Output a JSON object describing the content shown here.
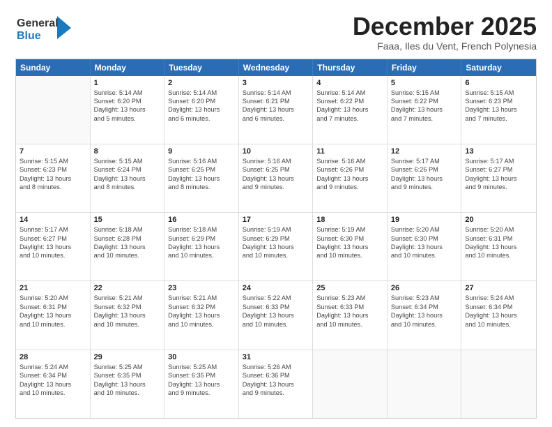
{
  "header": {
    "logo_general": "General",
    "logo_blue": "Blue",
    "month": "December 2025",
    "location": "Faaa, Iles du Vent, French Polynesia"
  },
  "days_of_week": [
    "Sunday",
    "Monday",
    "Tuesday",
    "Wednesday",
    "Thursday",
    "Friday",
    "Saturday"
  ],
  "weeks": [
    [
      {
        "day": "",
        "lines": []
      },
      {
        "day": "1",
        "lines": [
          "Sunrise: 5:14 AM",
          "Sunset: 6:20 PM",
          "Daylight: 13 hours",
          "and 5 minutes."
        ]
      },
      {
        "day": "2",
        "lines": [
          "Sunrise: 5:14 AM",
          "Sunset: 6:20 PM",
          "Daylight: 13 hours",
          "and 6 minutes."
        ]
      },
      {
        "day": "3",
        "lines": [
          "Sunrise: 5:14 AM",
          "Sunset: 6:21 PM",
          "Daylight: 13 hours",
          "and 6 minutes."
        ]
      },
      {
        "day": "4",
        "lines": [
          "Sunrise: 5:14 AM",
          "Sunset: 6:22 PM",
          "Daylight: 13 hours",
          "and 7 minutes."
        ]
      },
      {
        "day": "5",
        "lines": [
          "Sunrise: 5:15 AM",
          "Sunset: 6:22 PM",
          "Daylight: 13 hours",
          "and 7 minutes."
        ]
      },
      {
        "day": "6",
        "lines": [
          "Sunrise: 5:15 AM",
          "Sunset: 6:23 PM",
          "Daylight: 13 hours",
          "and 7 minutes."
        ]
      }
    ],
    [
      {
        "day": "7",
        "lines": [
          "Sunrise: 5:15 AM",
          "Sunset: 6:23 PM",
          "Daylight: 13 hours",
          "and 8 minutes."
        ]
      },
      {
        "day": "8",
        "lines": [
          "Sunrise: 5:15 AM",
          "Sunset: 6:24 PM",
          "Daylight: 13 hours",
          "and 8 minutes."
        ]
      },
      {
        "day": "9",
        "lines": [
          "Sunrise: 5:16 AM",
          "Sunset: 6:25 PM",
          "Daylight: 13 hours",
          "and 8 minutes."
        ]
      },
      {
        "day": "10",
        "lines": [
          "Sunrise: 5:16 AM",
          "Sunset: 6:25 PM",
          "Daylight: 13 hours",
          "and 9 minutes."
        ]
      },
      {
        "day": "11",
        "lines": [
          "Sunrise: 5:16 AM",
          "Sunset: 6:26 PM",
          "Daylight: 13 hours",
          "and 9 minutes."
        ]
      },
      {
        "day": "12",
        "lines": [
          "Sunrise: 5:17 AM",
          "Sunset: 6:26 PM",
          "Daylight: 13 hours",
          "and 9 minutes."
        ]
      },
      {
        "day": "13",
        "lines": [
          "Sunrise: 5:17 AM",
          "Sunset: 6:27 PM",
          "Daylight: 13 hours",
          "and 9 minutes."
        ]
      }
    ],
    [
      {
        "day": "14",
        "lines": [
          "Sunrise: 5:17 AM",
          "Sunset: 6:27 PM",
          "Daylight: 13 hours",
          "and 10 minutes."
        ]
      },
      {
        "day": "15",
        "lines": [
          "Sunrise: 5:18 AM",
          "Sunset: 6:28 PM",
          "Daylight: 13 hours",
          "and 10 minutes."
        ]
      },
      {
        "day": "16",
        "lines": [
          "Sunrise: 5:18 AM",
          "Sunset: 6:29 PM",
          "Daylight: 13 hours",
          "and 10 minutes."
        ]
      },
      {
        "day": "17",
        "lines": [
          "Sunrise: 5:19 AM",
          "Sunset: 6:29 PM",
          "Daylight: 13 hours",
          "and 10 minutes."
        ]
      },
      {
        "day": "18",
        "lines": [
          "Sunrise: 5:19 AM",
          "Sunset: 6:30 PM",
          "Daylight: 13 hours",
          "and 10 minutes."
        ]
      },
      {
        "day": "19",
        "lines": [
          "Sunrise: 5:20 AM",
          "Sunset: 6:30 PM",
          "Daylight: 13 hours",
          "and 10 minutes."
        ]
      },
      {
        "day": "20",
        "lines": [
          "Sunrise: 5:20 AM",
          "Sunset: 6:31 PM",
          "Daylight: 13 hours",
          "and 10 minutes."
        ]
      }
    ],
    [
      {
        "day": "21",
        "lines": [
          "Sunrise: 5:20 AM",
          "Sunset: 6:31 PM",
          "Daylight: 13 hours",
          "and 10 minutes."
        ]
      },
      {
        "day": "22",
        "lines": [
          "Sunrise: 5:21 AM",
          "Sunset: 6:32 PM",
          "Daylight: 13 hours",
          "and 10 minutes."
        ]
      },
      {
        "day": "23",
        "lines": [
          "Sunrise: 5:21 AM",
          "Sunset: 6:32 PM",
          "Daylight: 13 hours",
          "and 10 minutes."
        ]
      },
      {
        "day": "24",
        "lines": [
          "Sunrise: 5:22 AM",
          "Sunset: 6:33 PM",
          "Daylight: 13 hours",
          "and 10 minutes."
        ]
      },
      {
        "day": "25",
        "lines": [
          "Sunrise: 5:23 AM",
          "Sunset: 6:33 PM",
          "Daylight: 13 hours",
          "and 10 minutes."
        ]
      },
      {
        "day": "26",
        "lines": [
          "Sunrise: 5:23 AM",
          "Sunset: 6:34 PM",
          "Daylight: 13 hours",
          "and 10 minutes."
        ]
      },
      {
        "day": "27",
        "lines": [
          "Sunrise: 5:24 AM",
          "Sunset: 6:34 PM",
          "Daylight: 13 hours",
          "and 10 minutes."
        ]
      }
    ],
    [
      {
        "day": "28",
        "lines": [
          "Sunrise: 5:24 AM",
          "Sunset: 6:34 PM",
          "Daylight: 13 hours",
          "and 10 minutes."
        ]
      },
      {
        "day": "29",
        "lines": [
          "Sunrise: 5:25 AM",
          "Sunset: 6:35 PM",
          "Daylight: 13 hours",
          "and 10 minutes."
        ]
      },
      {
        "day": "30",
        "lines": [
          "Sunrise: 5:25 AM",
          "Sunset: 6:35 PM",
          "Daylight: 13 hours",
          "and 9 minutes."
        ]
      },
      {
        "day": "31",
        "lines": [
          "Sunrise: 5:26 AM",
          "Sunset: 6:36 PM",
          "Daylight: 13 hours",
          "and 9 minutes."
        ]
      },
      {
        "day": "",
        "lines": []
      },
      {
        "day": "",
        "lines": []
      },
      {
        "day": "",
        "lines": []
      }
    ]
  ]
}
